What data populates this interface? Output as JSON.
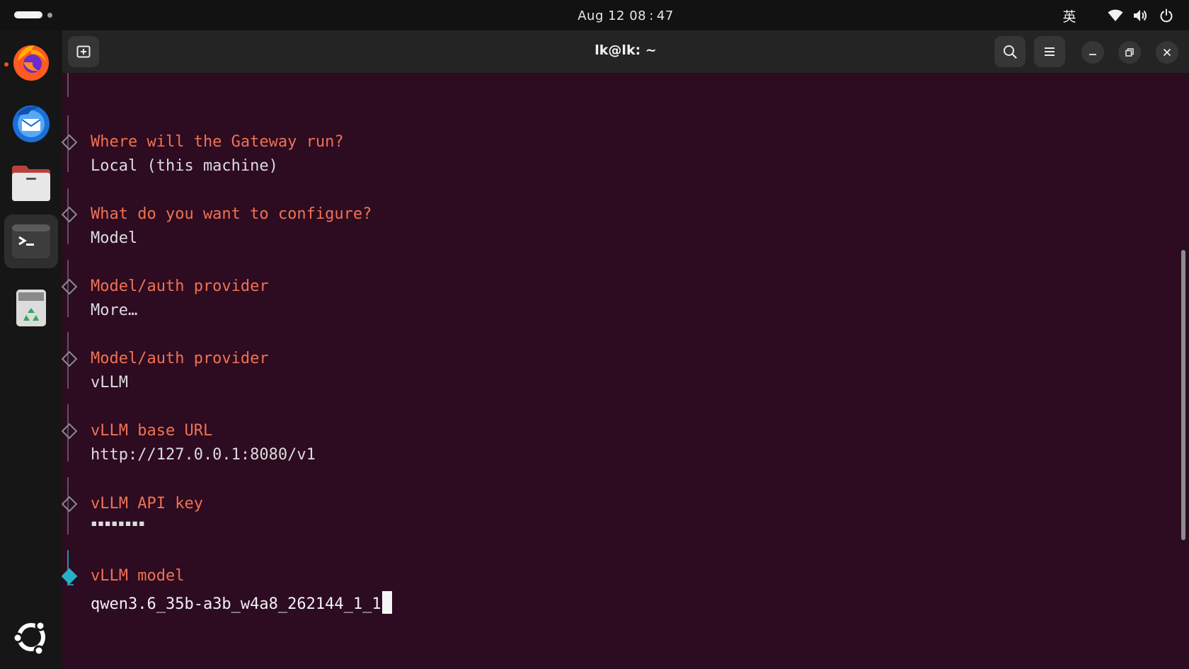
{
  "topbar": {
    "clock": "Aug 12  08 : 47",
    "input_method": "英",
    "icons": [
      "activities-indicator",
      "wifi-icon",
      "volume-icon",
      "power-icon"
    ]
  },
  "dock": {
    "apps": [
      "firefox",
      "thunderbird",
      "files",
      "terminal",
      "trash"
    ],
    "running": [
      "firefox",
      "terminal"
    ],
    "active": "terminal",
    "bottom": "show-apps-ubuntu-logo"
  },
  "window": {
    "title": "lk@lk: ~",
    "header_buttons": [
      "new-tab",
      "search",
      "menu",
      "minimize",
      "restore",
      "close"
    ]
  },
  "terminal": {
    "steps": [
      {
        "question": "Where will the Gateway run?",
        "answer": "Local (this machine)"
      },
      {
        "question": "What do you want to configure?",
        "answer": "Model"
      },
      {
        "question": "Model/auth provider",
        "answer": "More…"
      },
      {
        "question": "Model/auth provider",
        "answer": "vLLM"
      },
      {
        "question": "vLLM base URL",
        "answer": "http://127.0.0.1:8080/v1"
      },
      {
        "question": "vLLM API key",
        "answer": "▪▪▪▪▪▪▪▪"
      },
      {
        "question": "vLLM model",
        "answer": "qwen3.6_35b-a3b_w4a8_262144_1_1",
        "active": true
      }
    ]
  },
  "colors": {
    "terminal_bg": "#2d0b21",
    "question": "#ef7252",
    "answer": "#dcdcdc",
    "accent": "#27b0c3",
    "header_bg": "#242424"
  }
}
